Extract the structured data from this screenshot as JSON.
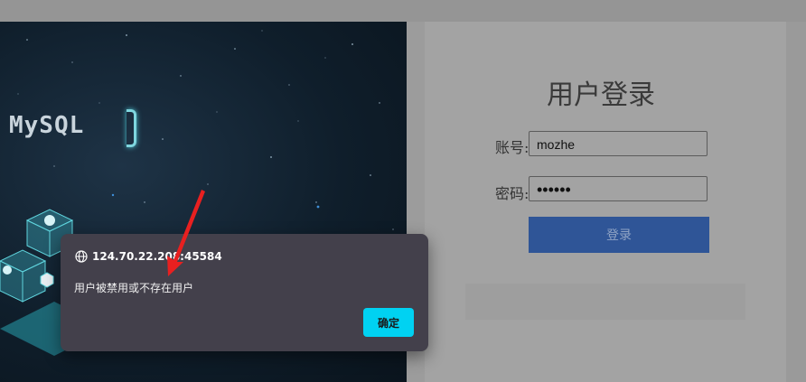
{
  "hero": {
    "logo_text": "MySQL"
  },
  "login": {
    "title": "用户登录",
    "account_label": "账号:",
    "account_value": "mozhe",
    "password_label": "密码:",
    "password_mask": "••••••",
    "submit_label": "登录"
  },
  "alert": {
    "origin": "124.70.22.208:45584",
    "message": "用户被禁用或不存在用户",
    "ok_label": "确定"
  },
  "icons": {
    "origin": "globe-icon",
    "annotation": "red-arrow"
  },
  "colors": {
    "login_button": "#2f5597",
    "dialog_bg": "#43404b",
    "ok_button": "#00d2f2",
    "annotation": "#e82020"
  }
}
